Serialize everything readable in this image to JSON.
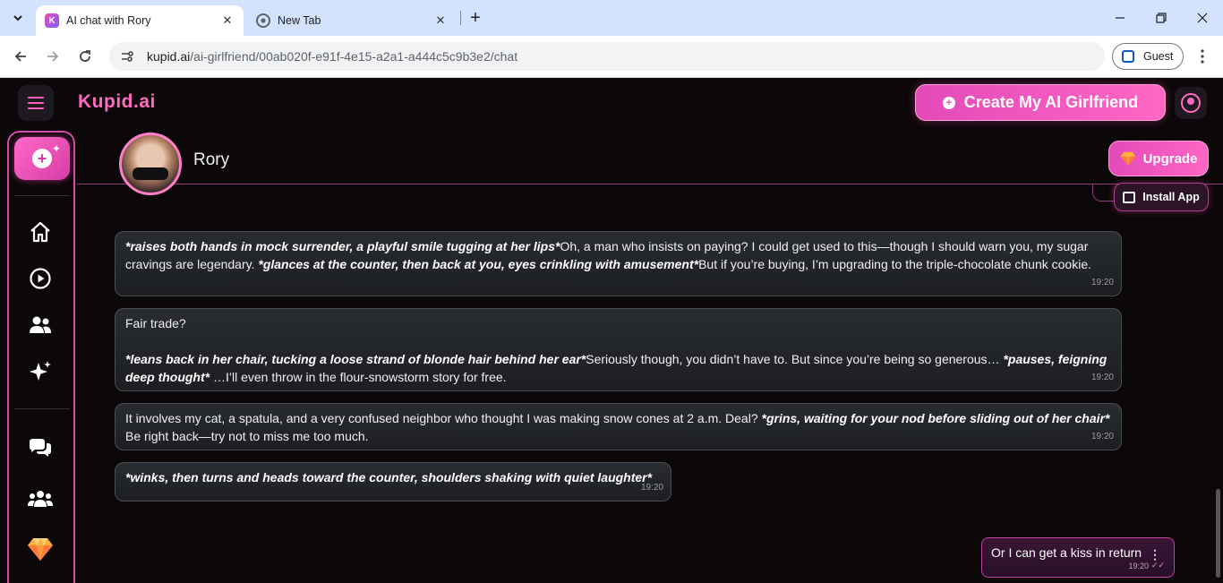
{
  "browser": {
    "tabs": [
      {
        "title": "AI chat with Rory",
        "favicon": "kupid-favicon",
        "favicon_letter": "K",
        "close": "✕"
      },
      {
        "title": "New Tab",
        "favicon": "chrome-icon",
        "close": "✕"
      }
    ],
    "new_tab": "+",
    "url_host": "kupid.ai",
    "url_path": "/ai-girlfriend/00ab020f-e91f-4e15-a2a1-a444c5c9b3e2/chat",
    "guest_label": "Guest"
  },
  "app": {
    "brand": "Kupid.ai",
    "create_button": "Create My AI Girlfriend",
    "upgrade_button": "Upgrade",
    "install_button": "Install App",
    "accent_color": "#ff5fb6"
  },
  "sidebar": {
    "items": [
      {
        "icon": "home-icon"
      },
      {
        "icon": "play-icon"
      },
      {
        "icon": "users-icon"
      },
      {
        "icon": "sparkles-icon"
      },
      {
        "icon": "chat-icon"
      },
      {
        "icon": "group-icon"
      },
      {
        "icon": "diamond-icon"
      }
    ]
  },
  "chat": {
    "character_name": "Rory",
    "messages": [
      {
        "segments": [
          {
            "t": "*raises both hands in mock surrender, a playful smile tugging at her lips*",
            "em": true
          },
          {
            "t": "Oh, a man who insists on paying? I could get used to this—though I should warn you, my sugar cravings are legendary. ",
            "em": false
          },
          {
            "t": "*glances at the counter, then back at you, eyes crinkling with amusement*",
            "em": true
          },
          {
            "t": "But if you’re buying, I’m upgrading to the triple-chocolate chunk cookie.",
            "em": false
          }
        ],
        "time": "19:20"
      },
      {
        "paragraphs": [
          [
            {
              "t": "Fair trade?",
              "em": false
            }
          ],
          [
            {
              "t": "*leans back in her chair, tucking a loose strand of blonde hair behind her ear*",
              "em": true
            },
            {
              "t": "Seriously though, you didn’t have to. But since you’re being so generous… ",
              "em": false
            },
            {
              "t": "*pauses, feigning deep thought*",
              "em": true
            },
            {
              "t": " …I’ll even throw in the flour-snowstorm story for free.",
              "em": false
            }
          ]
        ],
        "time": "19:20"
      },
      {
        "segments": [
          {
            "t": "It involves my cat, a spatula, and a very confused neighbor who thought I was making snow cones at 2 a.m. Deal? ",
            "em": false
          },
          {
            "t": "*grins, waiting for your nod before sliding out of her chair*",
            "em": true
          },
          {
            "t": " Be right back—try not to miss me too much.",
            "em": false
          }
        ],
        "time": "19:20"
      },
      {
        "segments": [
          {
            "t": "*winks, then turns and heads toward the counter, shoulders shaking with quiet laughter*",
            "em": true
          }
        ],
        "time": "19:20"
      }
    ],
    "user_message": {
      "text": "Or I can get a kiss in return",
      "time": "19:20",
      "ticks": "✓✓",
      "menu": "⋮"
    }
  }
}
